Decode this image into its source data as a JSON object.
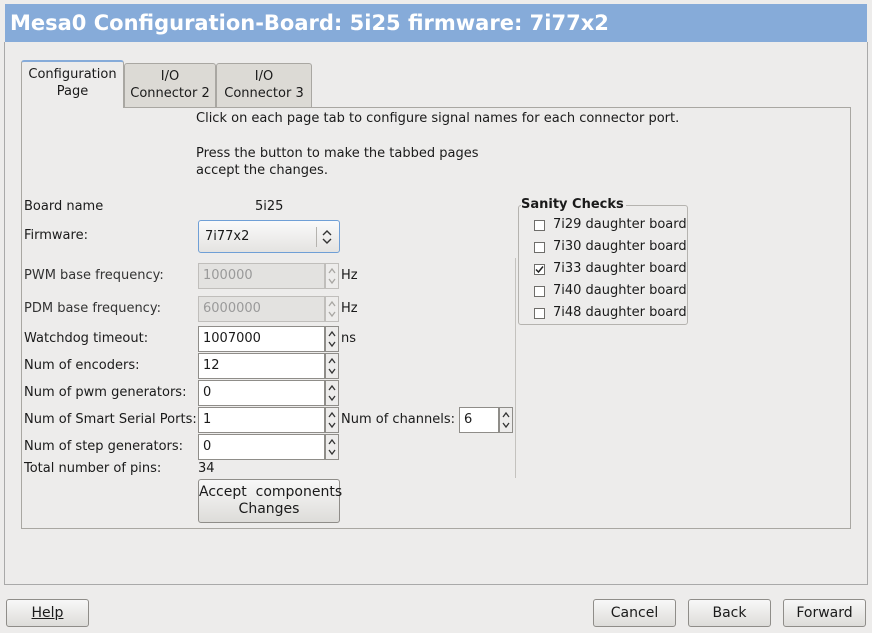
{
  "title": "Mesa0 Configuration-Board: 5i25 firmware: 7i77x2",
  "tabs": [
    {
      "line1": "Configuration",
      "line2": "Page"
    },
    {
      "line1": "I/O",
      "line2": "Connector 2"
    },
    {
      "line1": "I/O",
      "line2": "Connector 3"
    }
  ],
  "info": {
    "line1": "Click on each page tab to configure signal names for each connector port.",
    "line2": "Press the button to make the tabbed pages",
    "line3": "accept the changes."
  },
  "board": {
    "label": "Board name",
    "value": "5i25"
  },
  "firmware": {
    "label": "Firmware:",
    "value": "7i77x2"
  },
  "pwm_freq": {
    "label": "PWM base frequency:",
    "value": "100000",
    "unit": "Hz"
  },
  "pdm_freq": {
    "label": "PDM base frequency:",
    "value": "6000000",
    "unit": "Hz"
  },
  "watchdog": {
    "label": "Watchdog timeout:",
    "value": "1007000",
    "unit": "ns"
  },
  "encoders": {
    "label": "Num of encoders:",
    "value": "12"
  },
  "pwm_gen": {
    "label": "Num of pwm generators:",
    "value": "0"
  },
  "sserial": {
    "label": "Num of Smart Serial Ports:",
    "value": "1",
    "channels_label": "Num of channels:",
    "channels_value": "6"
  },
  "stepgen": {
    "label": "Num of step generators:",
    "value": "0"
  },
  "total_pins": {
    "label": "Total number of pins:",
    "value": "34"
  },
  "accept_button": {
    "line1": "Accept  components",
    "line2": "Changes"
  },
  "sanity": {
    "title": "Sanity Checks",
    "items": [
      {
        "label": "7i29 daughter board",
        "checked": false
      },
      {
        "label": "7i30 daughter board",
        "checked": false
      },
      {
        "label": "7i33 daughter board",
        "checked": true
      },
      {
        "label": "7i40 daughter board",
        "checked": false
      },
      {
        "label": "7i48 daughter board",
        "checked": false
      }
    ]
  },
  "footer": {
    "help": "Help",
    "cancel": "Cancel",
    "back": "Back",
    "forward": "Forward"
  },
  "colors": {
    "title_bg": "#86abd9",
    "window_bg": "#edeceb"
  }
}
